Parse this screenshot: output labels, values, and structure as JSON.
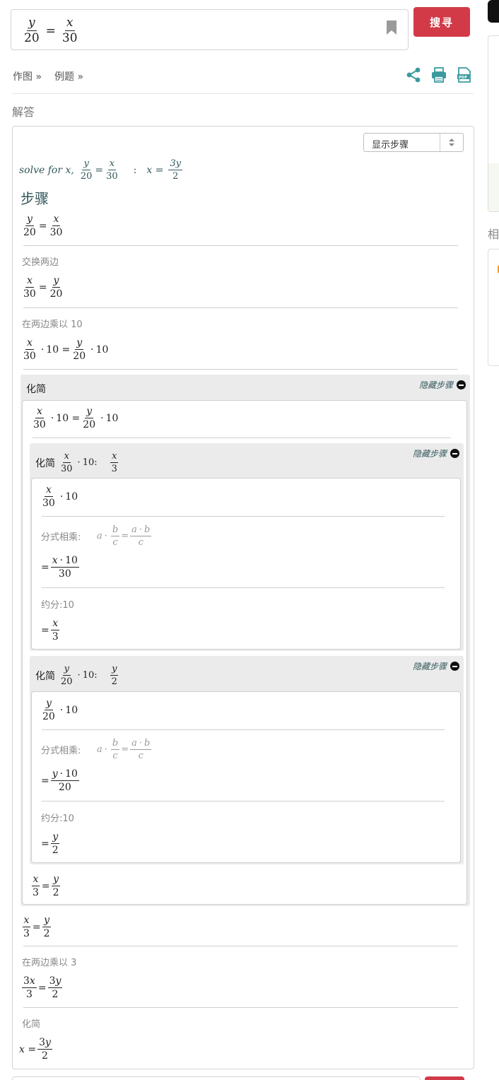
{
  "search": {
    "query_y": "y",
    "query_d1": "20",
    "query_eq": "=",
    "query_x": "x",
    "query_d2": "30",
    "button_label": "搜寻"
  },
  "toolbar": {
    "graph_link": "作图 »",
    "examples_link": "例题 »"
  },
  "answer_label": "解答",
  "steps_select": {
    "selected": "显示步骤"
  },
  "summary": {
    "prefix": "solve for x,",
    "sep": ":",
    "result_lhs": "x =",
    "result_num": "3y",
    "result_den": "2"
  },
  "steps_title": "步骤",
  "desc": {
    "swap": "交换两边",
    "mult10": "在两边乘以 10",
    "frac_mult": "分式相乘:",
    "reduce10": "约分:10",
    "mult3": "在两边乘以 3",
    "simplify": "化简"
  },
  "sub": {
    "title_simplify": "化简",
    "hide_label": "隐藏步骤",
    "title_simplify_x": "化简",
    "title_simplify_y": "化简"
  },
  "right_rail": {
    "title_fragment": "相"
  }
}
